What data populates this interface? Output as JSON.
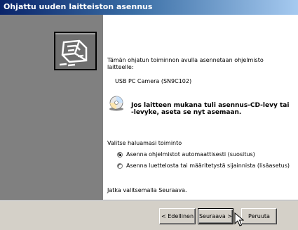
{
  "window": {
    "title": "Ohjattu uuden laitteiston asennus"
  },
  "content": {
    "intro": "Tämän ohjatun toiminnon avulla asennetaan ohjelmisto",
    "intro_line2": "laitteelle:",
    "device_name": "USB PC Camera (SN9C102)",
    "cd_prompt_line1": "Jos laitteen mukana tuli asennus-CD-levy tai",
    "cd_prompt_line2": "-levyke, aseta se nyt asemaan.",
    "choose_action": "Valitse haluamasi toiminto",
    "options": [
      {
        "label": "Asenna ohjelmistot automaattisesti (suositus)",
        "selected": true
      },
      {
        "label": "Asenna luettelosta tai määritetystä sijainnista (lisäasetus)",
        "selected": false
      }
    ],
    "continue_hint": "Jatka valitsemalla Seuraava."
  },
  "buttons": {
    "back": "< Edellinen",
    "next": "Seuraava >",
    "cancel": "Peruuta"
  },
  "icons": {
    "wizard": "hardware-wizard-icon",
    "cd": "cd-disc-icon",
    "cursor": "mouse-pointer-icon"
  },
  "colors": {
    "title_start": "#0a246a",
    "title_end": "#a6caf0",
    "face": "#d4d0c8",
    "sidebar": "#808080"
  }
}
